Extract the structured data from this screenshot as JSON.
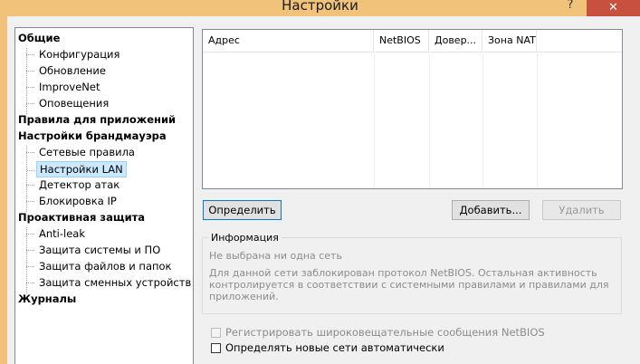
{
  "window": {
    "title": "Настройки",
    "help_glyph": "?",
    "close_glyph": "✕"
  },
  "tree": {
    "categories": [
      {
        "label": "Общие",
        "items": [
          "Конфигурация",
          "Обновление",
          "ImproveNet",
          "Оповещения"
        ]
      },
      {
        "label": "Правила для приложений",
        "items": []
      },
      {
        "label": "Настройки брандмауэра",
        "items": [
          "Сетевые правила",
          "Настройки LAN",
          "Детектор атак",
          "Блокировка IP"
        ]
      },
      {
        "label": "Проактивная защита",
        "items": [
          "Anti-leak",
          "Защита системы и ПО",
          "Защита файлов и папок",
          "Защита сменных устройств"
        ]
      },
      {
        "label": "Журналы",
        "items": []
      }
    ],
    "selected": "Настройки LAN"
  },
  "table": {
    "columns": [
      "Адрес",
      "NetBIOS",
      "Довер...",
      "Зона NAT"
    ],
    "rows": []
  },
  "buttons": {
    "detect": "Определить",
    "add": "Добавить...",
    "remove": "Удалить"
  },
  "info": {
    "title": "Информация",
    "status": "Не выбрана ни одна сеть",
    "description": "Для данной сети заблокирован протокол NetBIOS. Остальная активность контролируется в соответствии с системными правилами и правилами для приложений."
  },
  "options": {
    "log_netbios": {
      "label": "Регистрировать широковещательные сообщения NetBIOS",
      "checked": false,
      "enabled": false
    },
    "detect_new": {
      "label": "Определять новые сети автоматически",
      "checked": false,
      "enabled": true
    }
  },
  "colors": {
    "titlebar": "#f0c27a",
    "close": "#c7503f",
    "selection": "#cce8ff"
  }
}
